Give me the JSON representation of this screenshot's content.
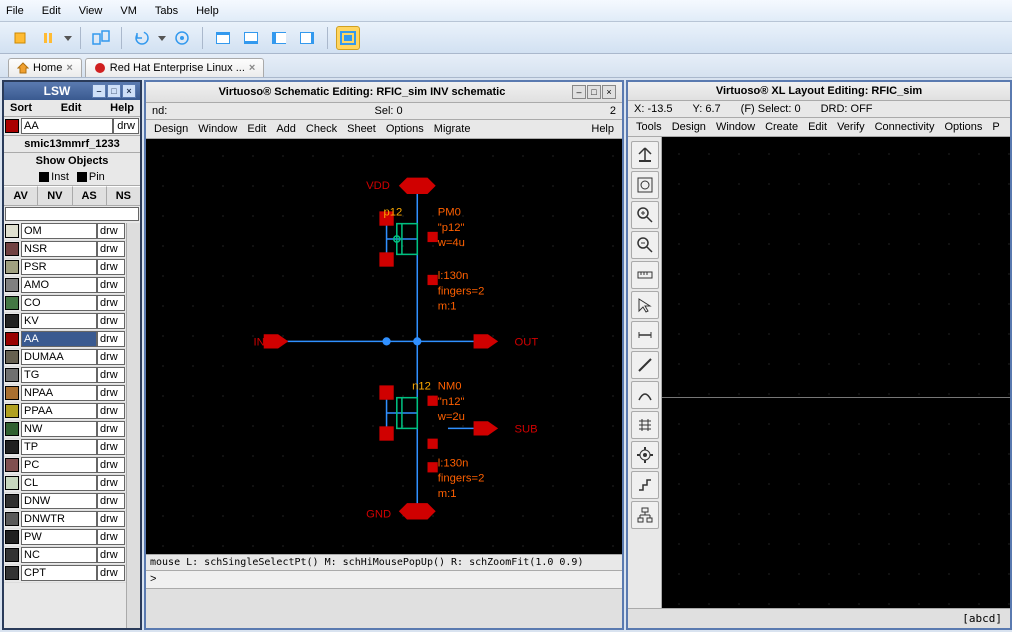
{
  "top_menu": [
    "File",
    "Edit",
    "View",
    "VM",
    "Tabs",
    "Help"
  ],
  "tabs": [
    {
      "icon": "home",
      "label": "Home"
    },
    {
      "icon": "redhat",
      "label": "Red Hat Enterprise Linux ..."
    }
  ],
  "lsw": {
    "title": "LSW",
    "menu": [
      "Sort",
      "Edit",
      "Help"
    ],
    "sel_layer": "AA",
    "sel_purpose": "drw",
    "library": "smic13mmrf_1233",
    "show_objects": "Show Objects",
    "inst_label": "Inst",
    "pin_label": "Pin",
    "view_tabs": [
      "AV",
      "NV",
      "AS",
      "NS"
    ],
    "layers": [
      {
        "name": "OM",
        "color": "#e0e0d0",
        "drw": "drw"
      },
      {
        "name": "NSR",
        "color": "#704040",
        "drw": "drw"
      },
      {
        "name": "PSR",
        "color": "#a0a080",
        "drw": "drw"
      },
      {
        "name": "AMO",
        "color": "#808080",
        "drw": "drw"
      },
      {
        "name": "CO",
        "color": "#447744",
        "drw": "drw"
      },
      {
        "name": "KV",
        "color": "#222222",
        "drw": "drw"
      },
      {
        "name": "AA",
        "color": "#990000",
        "drw": "drw",
        "selected": true
      },
      {
        "name": "DUMAA",
        "color": "#666050",
        "drw": "drw"
      },
      {
        "name": "TG",
        "color": "#707070",
        "drw": "drw"
      },
      {
        "name": "NPAA",
        "color": "#aa7030",
        "drw": "drw"
      },
      {
        "name": "PPAA",
        "color": "#b0a020",
        "drw": "drw"
      },
      {
        "name": "NW",
        "color": "#306030",
        "drw": "drw"
      },
      {
        "name": "TP",
        "color": "#202020",
        "drw": "drw"
      },
      {
        "name": "PC",
        "color": "#805050",
        "drw": "drw"
      },
      {
        "name": "CL",
        "color": "#c8d8c0",
        "drw": "drw"
      },
      {
        "name": "DNW",
        "color": "#303030",
        "drw": "drw"
      },
      {
        "name": "DNWTR",
        "color": "#585858",
        "drw": "drw"
      },
      {
        "name": "PW",
        "color": "#202020",
        "drw": "drw"
      },
      {
        "name": "NC",
        "color": "#333333",
        "drw": "drw"
      },
      {
        "name": "CPT",
        "color": "#333333",
        "drw": "drw"
      }
    ]
  },
  "schematic": {
    "title": "Virtuoso® Schematic Editing: RFIC_sim INV schematic",
    "cmd_label": "nd:",
    "sel_label": "Sel: 0",
    "page": "2",
    "menu": [
      "Design",
      "Window",
      "Edit",
      "Add",
      "Check",
      "Sheet",
      "Options",
      "Migrate"
    ],
    "help": "Help",
    "labels": {
      "vdd": "VDD",
      "gnd": "GND",
      "in": "IN",
      "out": "OUT",
      "sub": "SUB",
      "p12": "p12",
      "n12": "n12",
      "pm0": "PM0",
      "pm0_q": "\"p12\"",
      "pm0_w": "w=4u",
      "nm0": "NM0",
      "nm0_q": "\"n12\"",
      "nm0_w": "w=2u",
      "l1": "l:130n",
      "fingers1": "fingers=2",
      "m1": "m:1",
      "l2": "l:130n",
      "fingers2": "fingers=2",
      "m2": "m:1"
    },
    "mouse_status": "mouse L: schSingleSelectPt() M: schHiMousePopUp()   R: schZoomFit(1.0 0.9)",
    "prompt": ">"
  },
  "layout": {
    "title": "Virtuoso® XL Layout Editing: RFIC_sim",
    "status": {
      "x": "X: -13.5",
      "y": "Y: 6.7",
      "sel": "(F) Select: 0",
      "drd": "DRD: OFF"
    },
    "menu": [
      "Tools",
      "Design",
      "Window",
      "Create",
      "Edit",
      "Verify",
      "Connectivity",
      "Options",
      "P"
    ],
    "footer": "[abcd]"
  }
}
